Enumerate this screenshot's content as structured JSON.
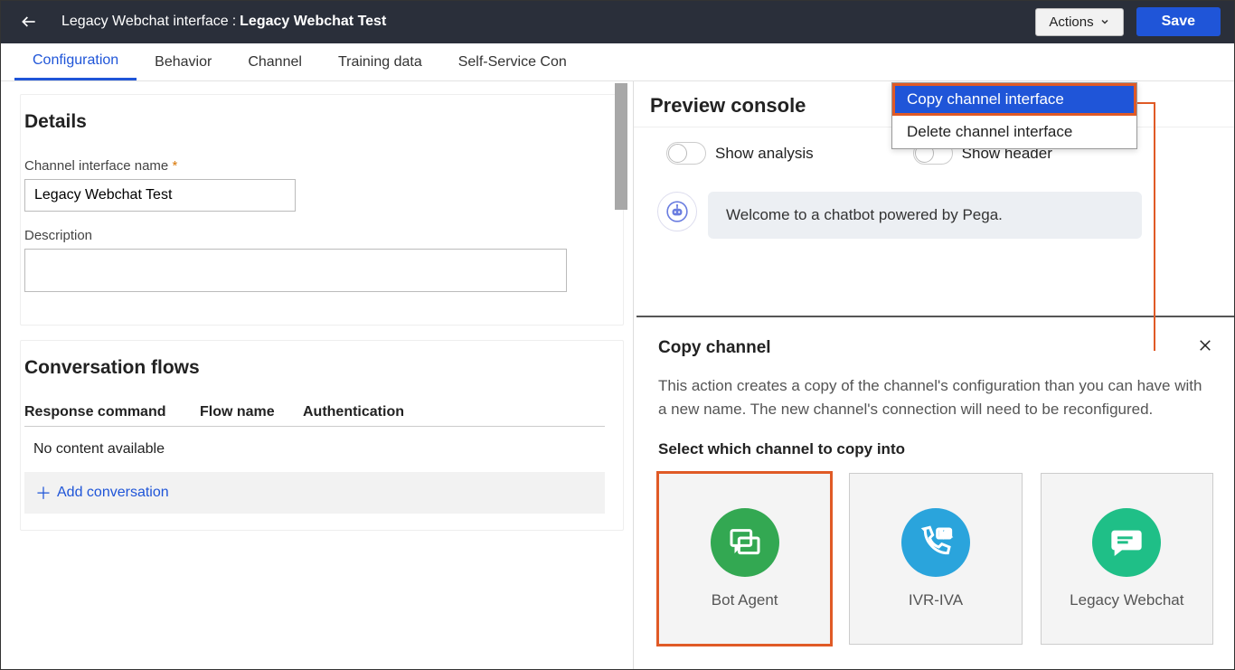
{
  "header": {
    "prefix": "Legacy Webchat interface",
    "name": "Legacy Webchat Test",
    "actions_label": "Actions",
    "save_label": "Save"
  },
  "actions_menu": {
    "copy": "Copy channel interface",
    "delete": "Delete channel interface"
  },
  "tabs": [
    "Configuration",
    "Behavior",
    "Channel",
    "Training data",
    "Self-Service Con"
  ],
  "active_tab": 0,
  "details": {
    "title": "Details",
    "name_label": "Channel interface name",
    "name_value": "Legacy Webchat Test",
    "desc_label": "Description"
  },
  "flows": {
    "title": "Conversation flows",
    "col1": "Response command",
    "col2": "Flow name",
    "col3": "Authentication",
    "empty": "No content available",
    "add": "Add conversation"
  },
  "preview": {
    "title": "Preview console",
    "toggle1": "Show analysis",
    "toggle2": "Show header",
    "welcome": "Welcome to a chatbot powered by Pega."
  },
  "copy_modal": {
    "title": "Copy channel",
    "desc": "This action creates a copy of the channel's configuration than you can have with a new name. The new channel's connection will need to be reconfigured.",
    "select_label": "Select which channel to copy into",
    "cards": [
      "Bot Agent",
      "IVR-IVA",
      "Legacy Webchat"
    ]
  }
}
